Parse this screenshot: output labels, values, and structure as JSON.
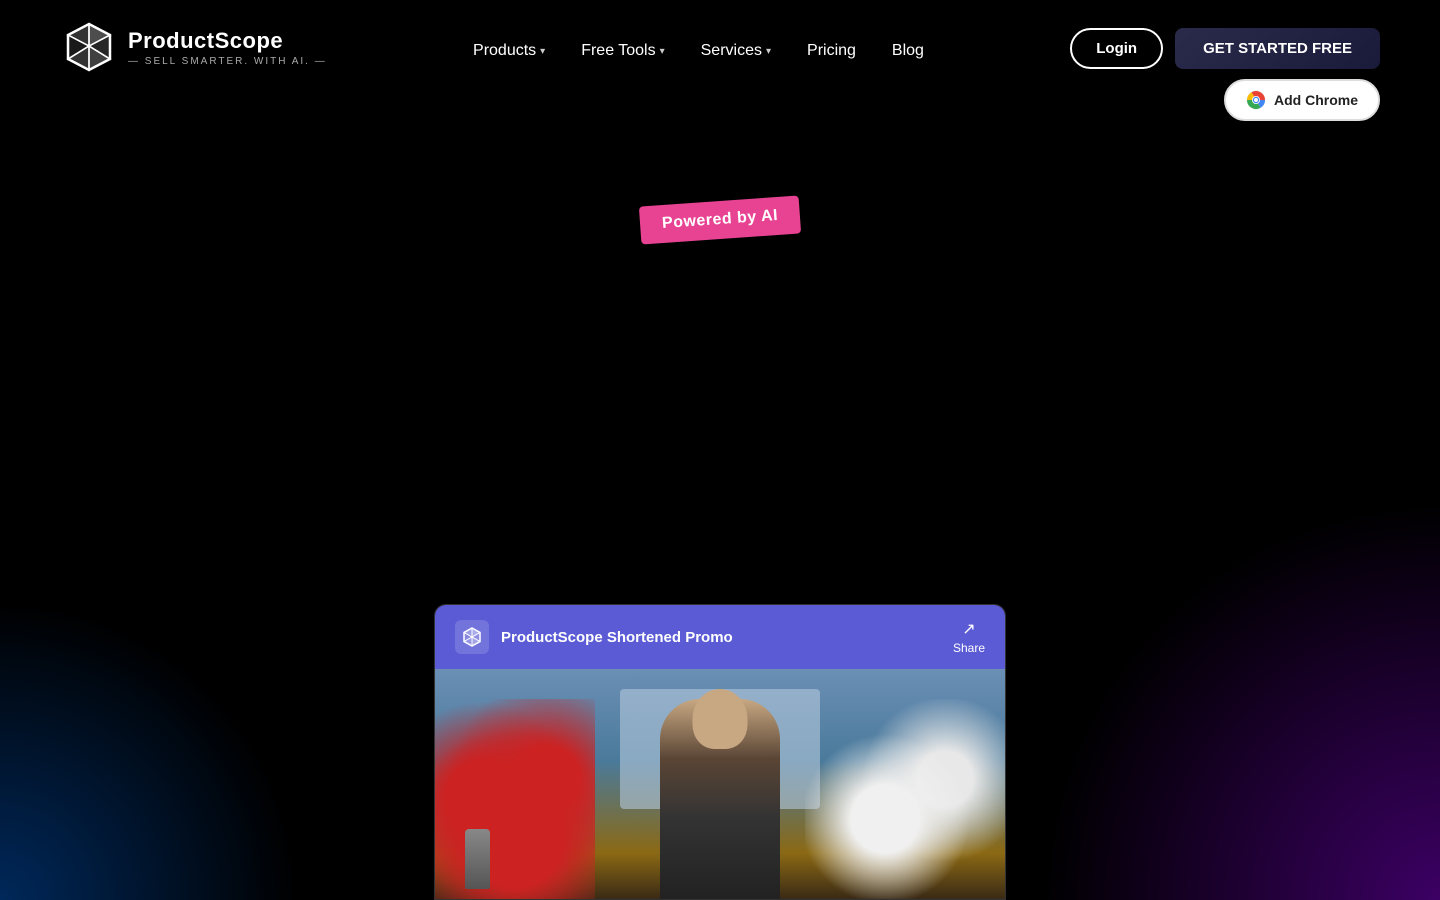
{
  "brand": {
    "name": "ProductScope",
    "tagline": "— SELL SMARTER. WITH AI. —"
  },
  "nav": {
    "links": [
      {
        "label": "Products",
        "hasDropdown": true
      },
      {
        "label": "Free Tools",
        "hasDropdown": true
      },
      {
        "label": "Services",
        "hasDropdown": true
      },
      {
        "label": "Pricing",
        "hasDropdown": false
      },
      {
        "label": "Blog",
        "hasDropdown": false
      }
    ]
  },
  "actions": {
    "login_label": "Login",
    "get_started_label": "GET STARTED FREE",
    "add_chrome_label": "Add Chrome"
  },
  "hero": {
    "badge_label": "Powered by AI"
  },
  "video": {
    "title": "ProductScope Shortened Promo",
    "share_label": "Share"
  },
  "colors": {
    "badge_bg": "#e84393",
    "video_header_bg": "#5b5bd6",
    "nav_bg": "#000"
  }
}
